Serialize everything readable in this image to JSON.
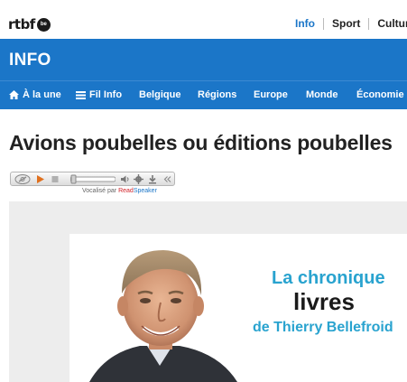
{
  "logo": {
    "text": "rtbf",
    "badge": "be"
  },
  "top_nav": [
    {
      "label": "Info",
      "active": true
    },
    {
      "label": "Sport",
      "active": false
    },
    {
      "label": "Culture",
      "active": false
    }
  ],
  "section": {
    "title": "INFO"
  },
  "main_nav": [
    {
      "label": "À la une",
      "icon": "home-icon"
    },
    {
      "label": "Fil Info",
      "icon": "list-icon"
    },
    {
      "label": "Belgique"
    },
    {
      "label": "Régions"
    },
    {
      "label": "Europe"
    },
    {
      "label": "Monde"
    },
    {
      "label": "Économie"
    }
  ],
  "article": {
    "title": "Avions poubelles ou éditions poubelles"
  },
  "player": {
    "credit_prefix": "Vocalisé par",
    "credit_brand_a": "Read",
    "credit_brand_b": "Speaker"
  },
  "banner": {
    "line1": "La chronique",
    "line2": "livres",
    "line3": "de Thierry Bellefroid"
  },
  "colors": {
    "brand_blue": "#1b76c8",
    "banner_cyan": "#29a3cf",
    "text_dark": "#222222"
  }
}
